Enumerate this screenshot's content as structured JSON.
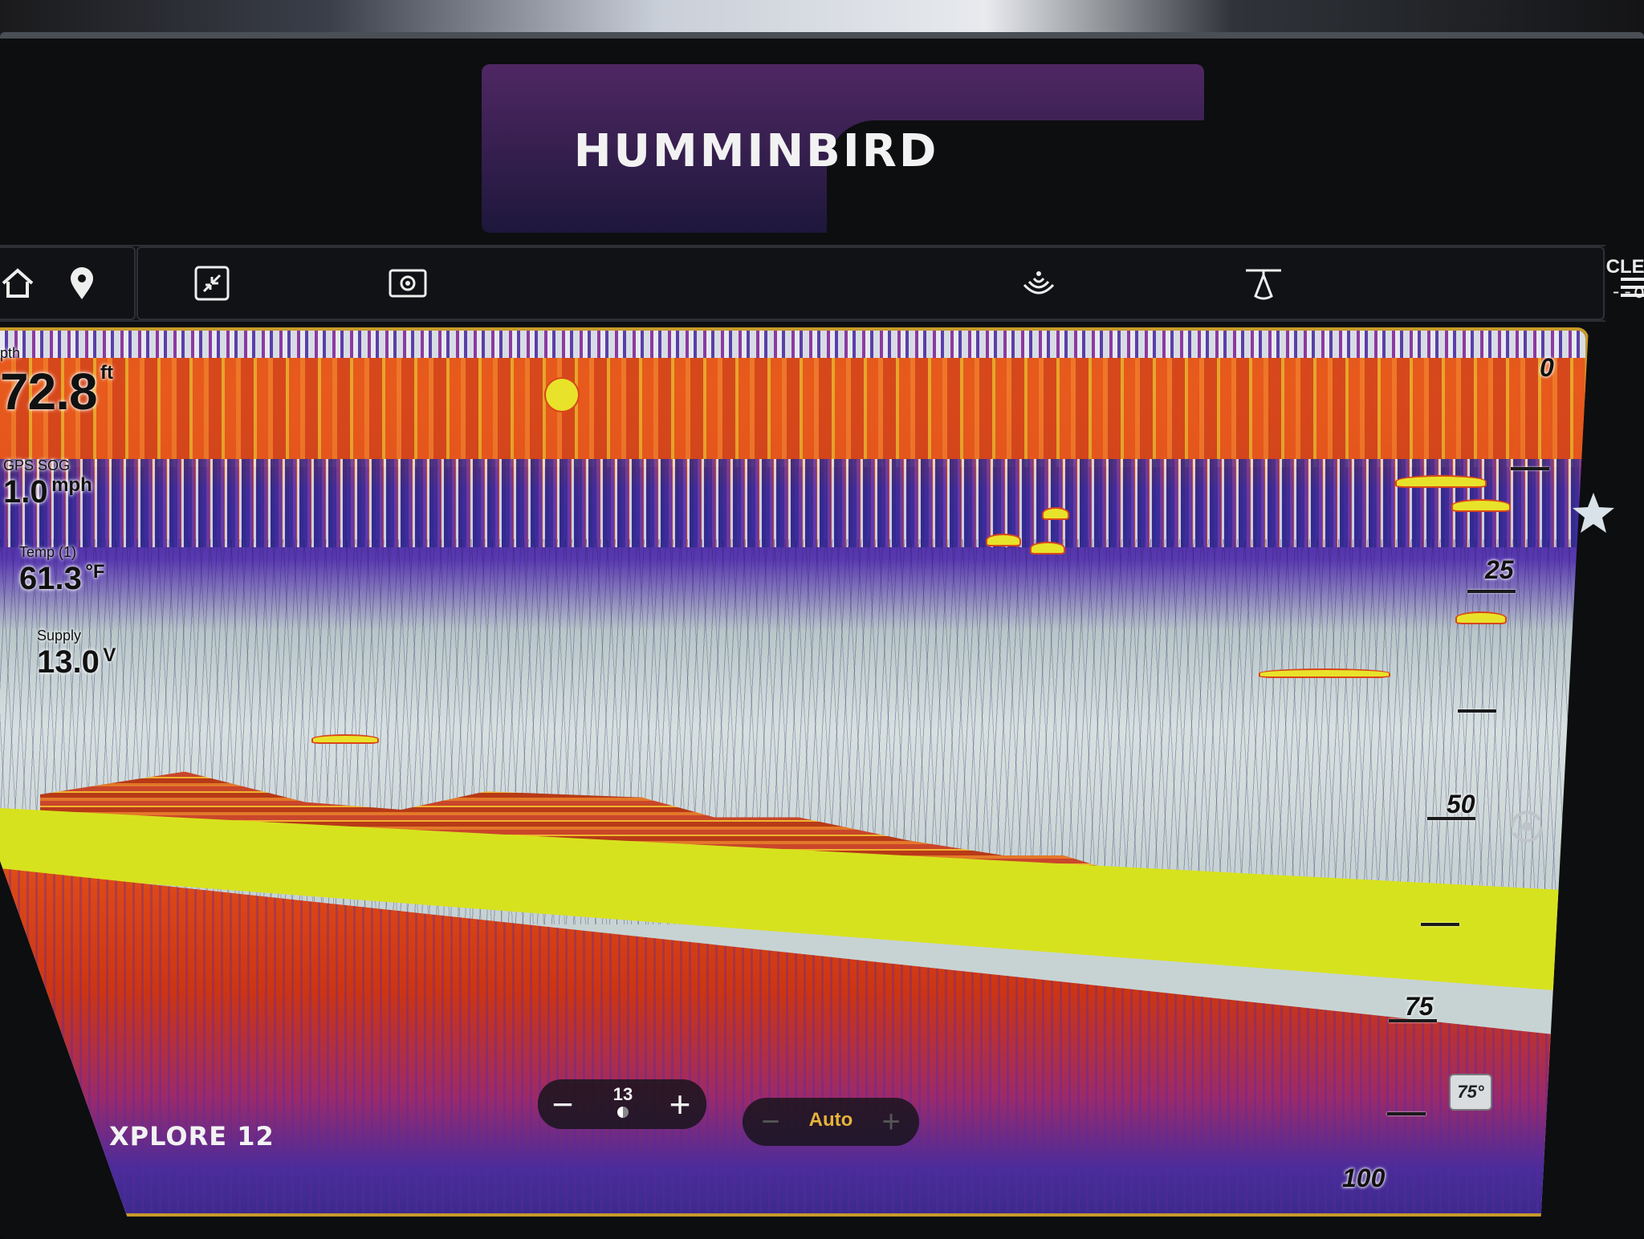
{
  "device": {
    "brand": "HUMMINBIRD",
    "model": "XPLORE 12"
  },
  "toolbar": {
    "clear_label": "CLEAR",
    "clear_slider": "--o +"
  },
  "readouts": {
    "depth_label": "pth",
    "depth_value": "72.8",
    "depth_unit": "ft",
    "sog_label": "GPS SOG",
    "sog_value": "1.0",
    "sog_unit": "mph",
    "temp_label": "Temp (1)",
    "temp_value": "61.3",
    "temp_unit": "°F",
    "supply_label": "Supply",
    "supply_value": "13.0",
    "supply_unit": "V"
  },
  "depth_scale": {
    "labels": [
      "0",
      "25",
      "50",
      "75",
      "100"
    ]
  },
  "range_control": {
    "value": "13",
    "minus": "−",
    "plus": "+"
  },
  "sensitivity_control": {
    "label": "Auto",
    "minus": "−",
    "plus": "+"
  },
  "temp_badge": "75°",
  "colors": {
    "frame_accent": "#c79a2a",
    "bottom_return": "#d7e21e",
    "strong_return": "#e2571b",
    "weak_return": "#4a2ba0",
    "auto_label": "#e6b43a"
  },
  "icons": [
    "home-icon",
    "map-pin-icon",
    "zoom-fit-icon",
    "settings-screen-icon",
    "sonar-signal-icon",
    "transducer-cone-icon",
    "menu-icon",
    "star-icon",
    "rotate-icon"
  ]
}
